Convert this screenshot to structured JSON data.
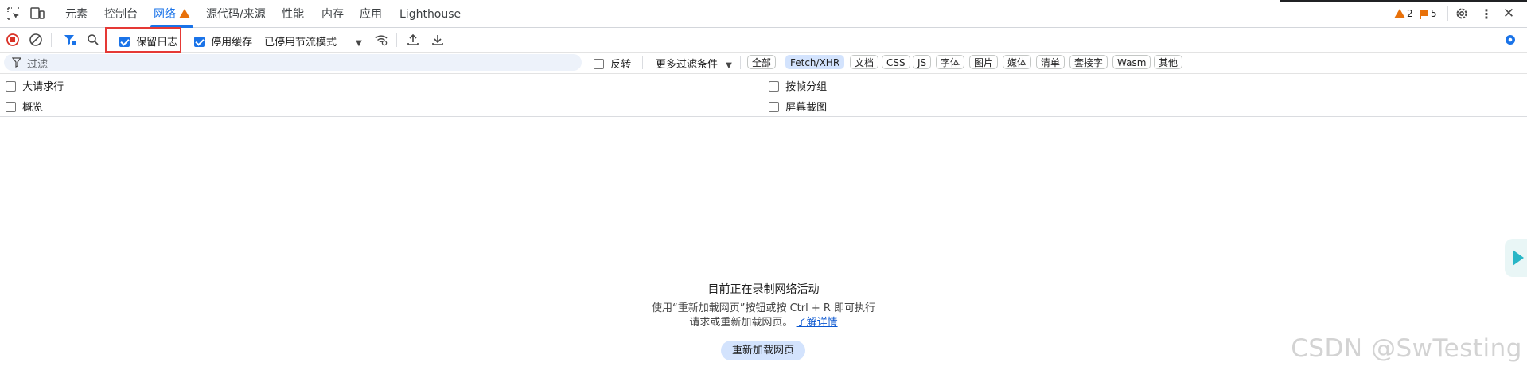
{
  "tabs": [
    {
      "label": "元素"
    },
    {
      "label": "控制台"
    },
    {
      "label": "网络"
    },
    {
      "label": "源代码/来源"
    },
    {
      "label": "性能"
    },
    {
      "label": "内存"
    },
    {
      "label": "应用"
    },
    {
      "label": "Lighthouse"
    }
  ],
  "status": {
    "warnings": "2",
    "issues": "5"
  },
  "toolbar": {
    "preserve_log": "保留日志",
    "disable_cache": "停用缓存",
    "throttling": "已停用节流模式"
  },
  "filter": {
    "placeholder": "过滤",
    "invert": "反转",
    "more_filters": "更多过滤条件",
    "types": [
      "全部",
      "Fetch/XHR",
      "文档",
      "CSS",
      "JS",
      "字体",
      "图片",
      "媒体",
      "清单",
      "套接字",
      "Wasm",
      "其他"
    ],
    "selected_type": "Fetch/XHR"
  },
  "options": {
    "large_rows": "大请求行",
    "overview": "概览",
    "group_by_frame": "按帧分组",
    "screenshots": "屏幕截图"
  },
  "empty_state": {
    "title": "目前正在录制网络活动",
    "line1": "使用“重新加载网页”按钮或按 Ctrl + R 即可执行",
    "line2": "请求或重新加载网页。",
    "link": "了解详情",
    "button": "重新加载网页"
  },
  "watermark": "CSDN @SwTesting",
  "colors": {
    "accent": "#1a73e8",
    "highlight_box": "#e53935",
    "record": "#d93025",
    "warning": "#e8710a"
  }
}
